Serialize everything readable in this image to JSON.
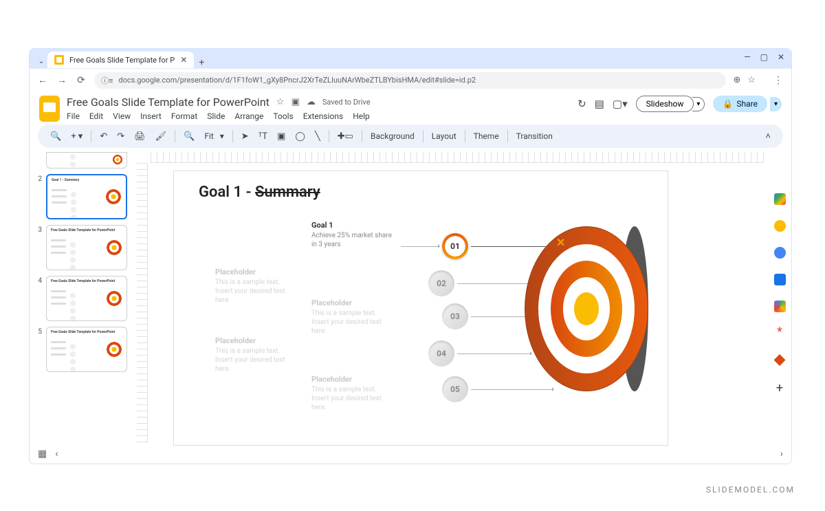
{
  "browser": {
    "tab_title": "Free Goals Slide Template for P",
    "url": "docs.google.com/presentation/d/1F1foW1_gXy8PncrJ2XrTeZLIuuNArWbeZTLBYbisHMA/edit#slide=id.p2"
  },
  "header": {
    "doc_title": "Free Goals Slide Template for PowerPoint",
    "save_status": "Saved to Drive",
    "slideshow": "Slideshow",
    "share": "Share"
  },
  "menus": [
    "File",
    "Edit",
    "View",
    "Insert",
    "Format",
    "Slide",
    "Arrange",
    "Tools",
    "Extensions",
    "Help"
  ],
  "toolbar": {
    "fit": "Fit",
    "background": "Background",
    "layout": "Layout",
    "theme": "Theme",
    "transition": "Transition"
  },
  "thumbs": {
    "t2_title": "Goal 1 - Summary",
    "t3_title": "Free Goals Slide Template for PowerPoint",
    "t4_title": "Free Goals Slide Template for PowerPoint",
    "t5_title": "Free Goals Slide Template for PowerPoint"
  },
  "slide": {
    "title_prefix": "Goal 1 - ",
    "title_strike": "Summary",
    "items": [
      {
        "head": "Goal 1",
        "text": "Achieve 25% market share in 3 years",
        "num": "01"
      },
      {
        "head": "Placeholder",
        "text": "This is a sample text. Insert your desired text here.",
        "num": "02"
      },
      {
        "head": "Placeholder",
        "text": "This is a sample text. Insert your desired text here.",
        "num": "03"
      },
      {
        "head": "Placeholder",
        "text": "This is a sample text. Insert your desired text here.",
        "num": "04"
      },
      {
        "head": "Placeholder",
        "text": "This is a sample text. Insert your desired text here.",
        "num": "05"
      }
    ]
  },
  "watermark": "SLIDEMODEL.COM"
}
